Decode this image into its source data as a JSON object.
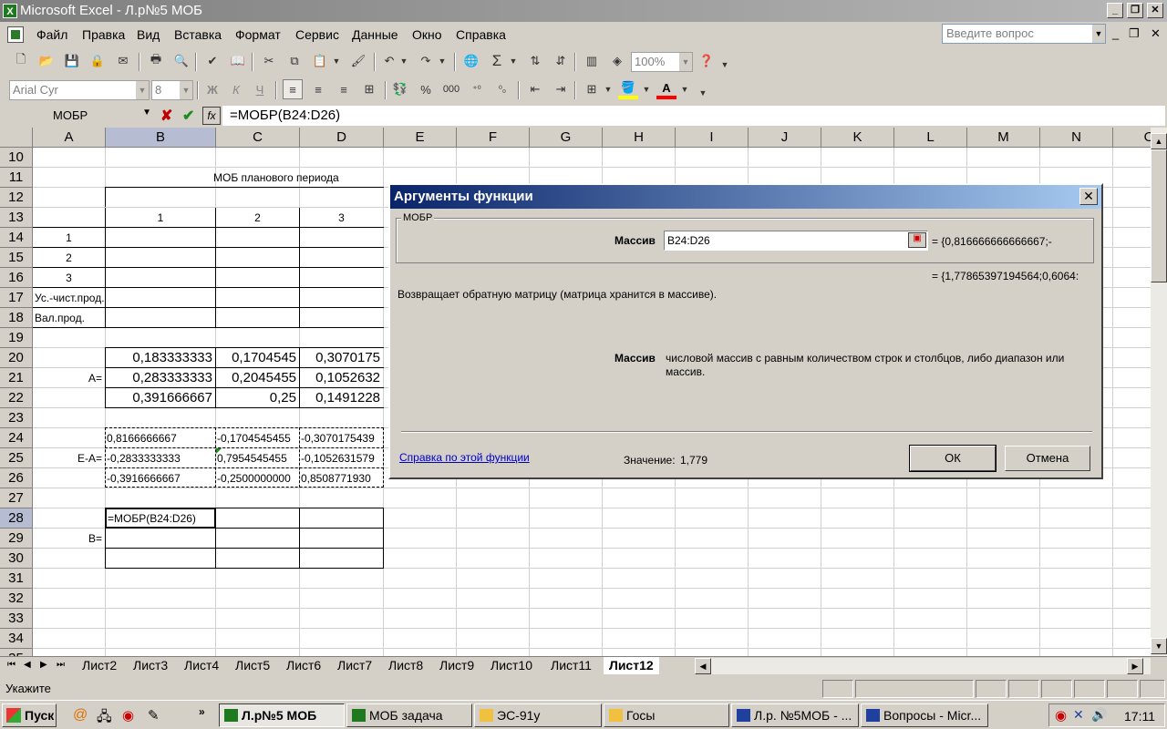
{
  "window": {
    "title": "Microsoft Excel - Л.р№5 МОБ"
  },
  "menu": [
    "Файл",
    "Правка",
    "Вид",
    "Вставка",
    "Формат",
    "Сервис",
    "Данные",
    "Окно",
    "Справка"
  ],
  "ask_placeholder": "Введите вопрос",
  "toolbar": {
    "zoom": "100%",
    "font": "Arial Cyr",
    "font_size": "8"
  },
  "formula_bar": {
    "name_box": "МОБР",
    "formula": "=МОБР(B24:D26)"
  },
  "columns": [
    "A",
    "B",
    "C",
    "D",
    "E",
    "F",
    "G",
    "H",
    "I",
    "J",
    "K",
    "L",
    "M",
    "N",
    "O"
  ],
  "rows": [
    "10",
    "11",
    "12",
    "13",
    "14",
    "15",
    "16",
    "17",
    "18",
    "19",
    "20",
    "21",
    "22",
    "23",
    "24",
    "25",
    "26",
    "27",
    "28",
    "29",
    "30",
    "31",
    "32",
    "33",
    "34",
    "35"
  ],
  "cells": {
    "title11": "МОБ планового периода",
    "h13_1": "1",
    "h13_2": "2",
    "h13_3": "3",
    "a14": "1",
    "a15": "2",
    "a16": "3",
    "a17": "Ус.-чист.прод.",
    "a18": "Вал.прод.",
    "a21": "A=",
    "b20": "0,183333333",
    "c20": "0,1704545",
    "d20": "0,3070175",
    "b21": "0,283333333",
    "c21": "0,2045455",
    "d21": "0,1052632",
    "b22": "0,391666667",
    "c22": "0,25",
    "d22": "0,1491228",
    "a25": "E-A=",
    "b24": "0,8166666667",
    "c24": "-0,1704545455",
    "d24": "-0,3070175439",
    "b25": "-0,2833333333",
    "c25": "0,7954545455",
    "d25": "-0,1052631579",
    "b26": "-0,3916666667",
    "c26": "-0,2500000000",
    "d26": "0,8508771930",
    "b28": "=МОБР(B24:D26)",
    "a29": "B="
  },
  "sheet_tabs": [
    "Лист2",
    "Лист3",
    "Лист4",
    "Лист5",
    "Лист6",
    "Лист7",
    "Лист8",
    "Лист9",
    "Лист10",
    "Лист11",
    "Лист12"
  ],
  "status": "Укажите",
  "dialog": {
    "title": "Аргументы функции",
    "group": "МОБР",
    "arg_label": "Массив",
    "arg_value": "B24:D26",
    "arg_result": "=  {0,816666666666667;-",
    "func_result": "=  {1,77865397194564;0,6064:",
    "description": "Возвращает обратную матрицу (матрица хранится в массиве).",
    "arg_help_label": "Массив",
    "arg_help_text": "числовой массив с равным количеством строк и столбцов, либо диапазон или массив.",
    "help_link": "Справка по этой функции",
    "value_label": "Значение:",
    "value": "1,779",
    "ok": "ОК",
    "cancel": "Отмена"
  },
  "taskbar": {
    "start": "Пуск",
    "items": [
      "Л.р№5 МОБ",
      "МОБ задача",
      "ЭС-91у",
      "Госы",
      "Л.р. №5МОБ - ...",
      "Вопросы - Micr..."
    ],
    "clock": "17:11"
  }
}
